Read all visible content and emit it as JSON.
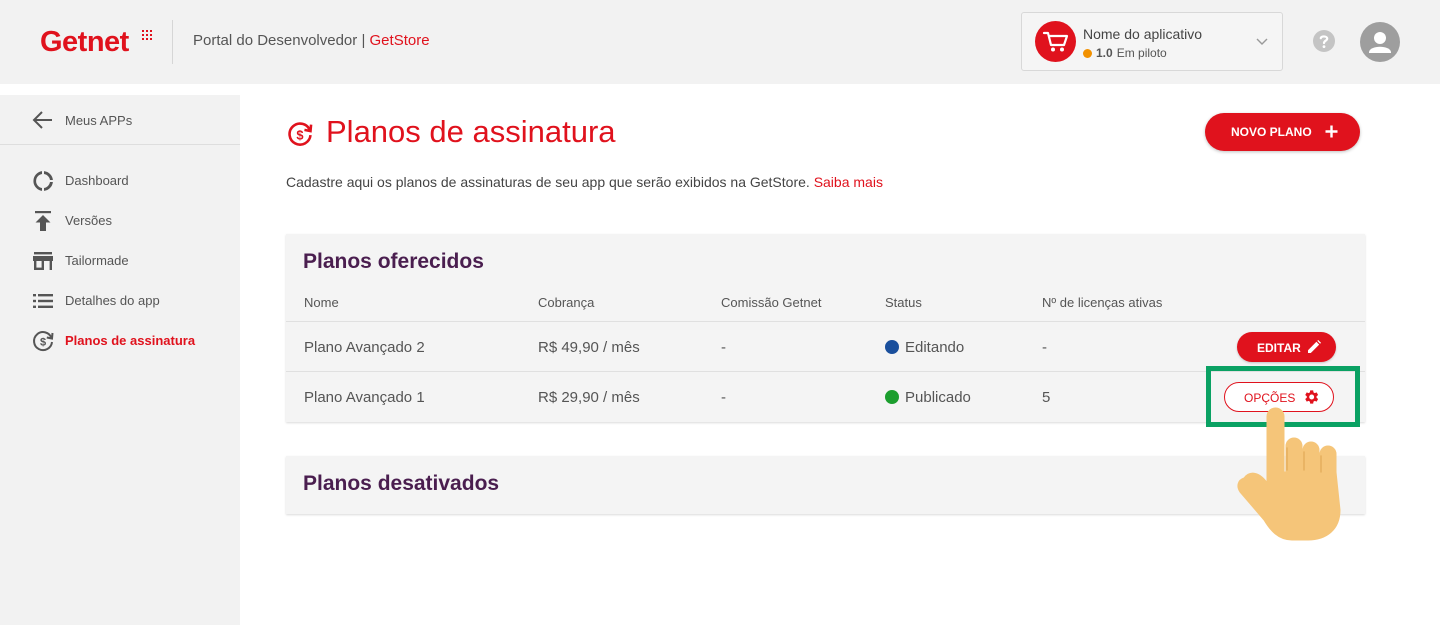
{
  "header": {
    "logo": "Getnet",
    "portal_title": "Portal do Desenvolvedor",
    "separator": "|",
    "store_name": "GetStore",
    "app_selector": {
      "app_name": "Nome do aplicativo",
      "version": "1.0",
      "status": "Em piloto",
      "status_color": "#f29100"
    }
  },
  "sidebar": {
    "back_label": "Meus APPs",
    "items": [
      {
        "label": "Dashboard",
        "icon": "dashboard-icon",
        "active": false
      },
      {
        "label": "Versões",
        "icon": "upload-icon",
        "active": false
      },
      {
        "label": "Tailormade",
        "icon": "store-icon",
        "active": false
      },
      {
        "label": "Detalhes do app",
        "icon": "list-icon",
        "active": false
      },
      {
        "label": "Planos de assinatura",
        "icon": "subscription-icon",
        "active": true
      }
    ]
  },
  "main": {
    "title": "Planos de assinatura",
    "subtitle": "Cadastre aqui os planos de assinaturas de seu app que serão exibidos na GetStore.",
    "learn_more": "Saiba mais",
    "new_plan_button": "NOVO PLANO",
    "offered": {
      "title": "Planos oferecidos",
      "columns": [
        "Nome",
        "Cobrança",
        "Comissão Getnet",
        "Status",
        "Nº de licenças ativas"
      ],
      "rows": [
        {
          "name": "Plano Avançado 2",
          "billing": "R$ 49,90 / mês",
          "commission": "-",
          "status": "Editando",
          "status_color": "#1a4f9c",
          "licenses": "-",
          "action": "EDITAR"
        },
        {
          "name": "Plano Avançado 1",
          "billing": "R$ 29,90 / mês",
          "commission": "-",
          "status": "Publicado",
          "status_color": "#1c9e2e",
          "licenses": "5",
          "action": "OPÇÕES"
        }
      ]
    },
    "disabled": {
      "title": "Planos desativados"
    }
  },
  "colors": {
    "brand": "#e0121d",
    "card_title": "#4a1e4f",
    "highlight": "#0aa163"
  }
}
